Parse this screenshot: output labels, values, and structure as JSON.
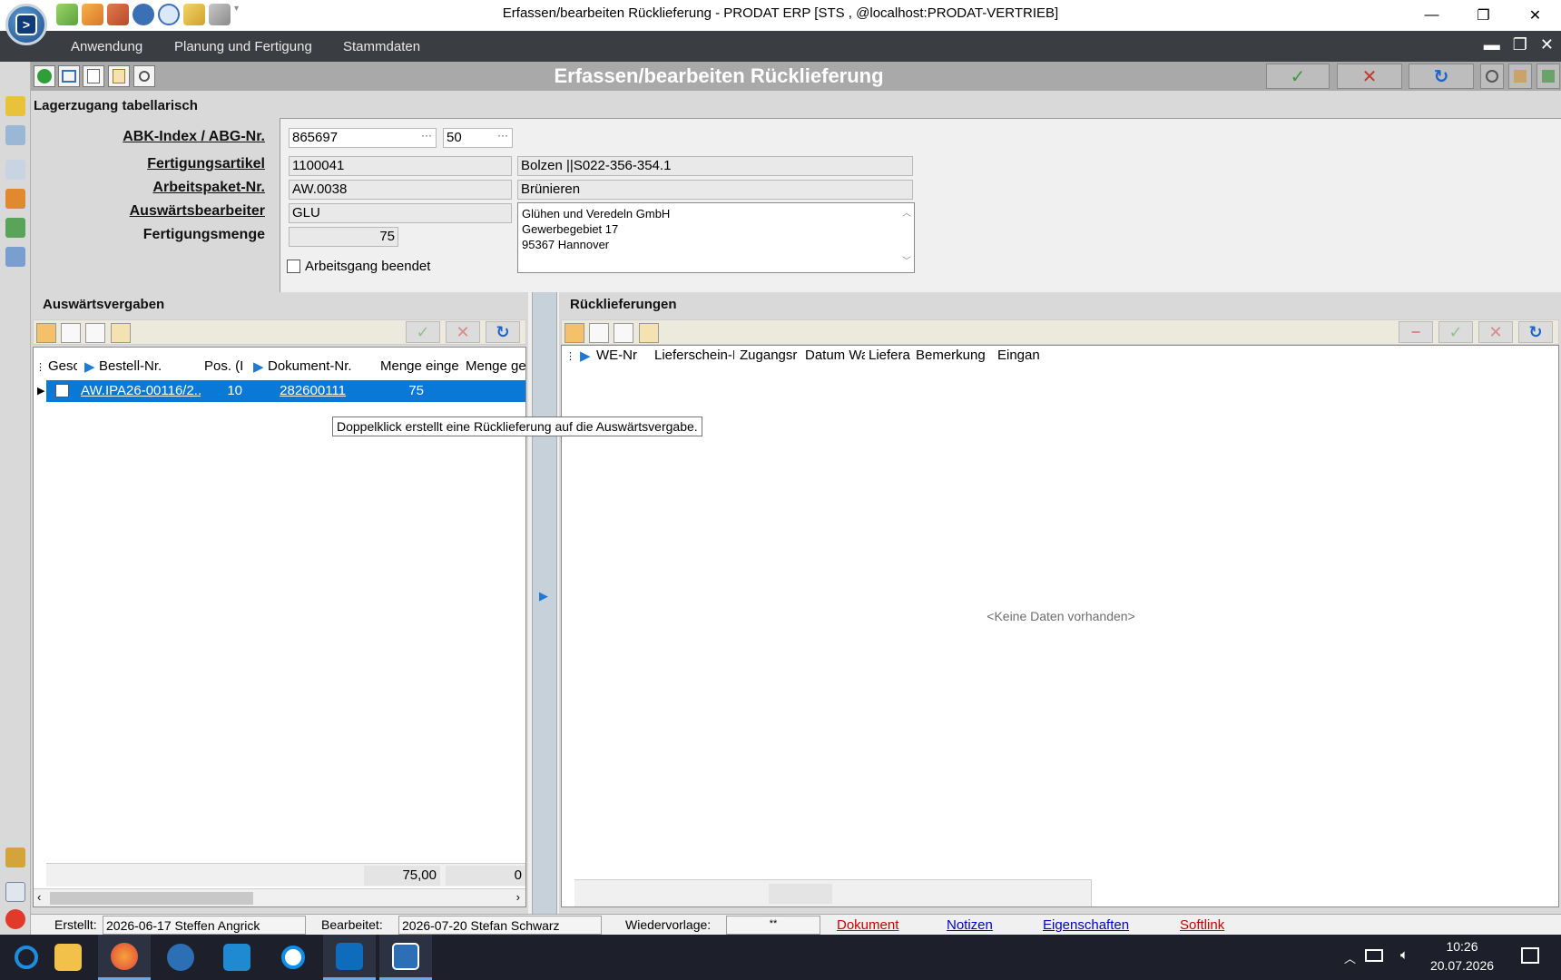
{
  "window": {
    "title": "Erfassen/bearbeiten Rücklieferung - PRODAT ERP   [STS ,  @localhost:PRODAT-VERTRIEB]",
    "minimize": "—",
    "restore": "❐",
    "close": "✕"
  },
  "menu": {
    "items": [
      "Anwendung",
      "Planung und Fertigung",
      "Stammdaten"
    ]
  },
  "form": {
    "title": "Erfassen/bearbeiten Rücklieferung"
  },
  "lager": {
    "title": "Lagerzugang tabellarisch",
    "labels": {
      "abk": "ABK-Index / ABG-Nr.",
      "artikel": "Fertigungsartikel",
      "arbeitspaket": "Arbeitspaket-Nr.",
      "bearbeiter": "Auswärtsbearbeiter",
      "menge": "Fertigungsmenge"
    },
    "values": {
      "abk_index": "865697",
      "abg_nr": "50",
      "artikel_nr": "1100041",
      "artikel_name": "Bolzen    ||S022-356-354.1",
      "arbeitspaket_nr": "AW.0038",
      "arbeitspaket_name": "Brünieren",
      "bearbeiter_code": "GLU",
      "menge": "75"
    },
    "address": [
      "Glühen und Veredeln GmbH",
      "Gewerbegebiet 17",
      "95367 Hannover"
    ],
    "checkbox_label": "Arbeitsgang beendet",
    "checkbox_checked": false
  },
  "left_panel": {
    "title": "Auswärtsvergaben",
    "columns": [
      "Gesc",
      "Bestell-Nr.",
      "Pos. (I",
      "Dokument-Nr.",
      "Menge einge",
      "Menge ge"
    ],
    "rows": [
      {
        "bestell_nr": "AW.IPA26-00116/2...",
        "pos": "10",
        "dokument_nr": "282600111",
        "menge_eingegangen": "75",
        "menge_ge": ""
      }
    ],
    "footer": {
      "menge_eingegangen": "75,00",
      "menge_ge": "0"
    },
    "tooltip": "Doppelklick erstellt eine Rücklieferung auf die Auswärtsvergabe."
  },
  "right_panel": {
    "title": "Rücklieferungen",
    "columns": [
      "WE-Nr",
      "Lieferschein-N",
      "Zugangsr",
      "Datum Wa",
      "Liefera",
      "Bemerkung",
      "Eingan"
    ],
    "empty_text": "<Keine Daten vorhanden>"
  },
  "status": {
    "erstellt_label": "Erstellt:",
    "erstellt_value": "2026-06-17  Steffen Angrick",
    "bearbeitet_label": "Bearbeitet:",
    "bearbeitet_value": "2026-07-20  Stefan Schwarz",
    "wiedervorlage_label": "Wiedervorlage:",
    "wiedervorlage_value": "**",
    "links": [
      "Dokument",
      "Notizen",
      "Eigenschaften",
      "Softlink"
    ]
  },
  "taskbar": {
    "time": "10:26",
    "date": "20.07.2026"
  },
  "colors": {
    "selection": "#0a78d7",
    "menubar": "#3a3d42",
    "link_red": "#cc0000",
    "link_blue": "#0000cc",
    "ok_green": "#3a9b3a",
    "cancel_red": "#c0392b",
    "refresh_blue": "#1e64c8"
  }
}
